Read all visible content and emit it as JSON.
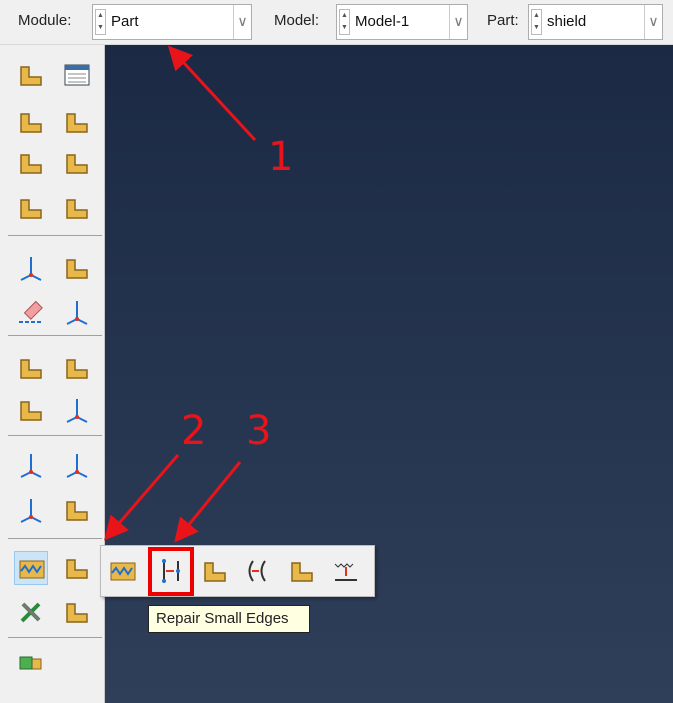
{
  "context_bar": {
    "module": {
      "label": "Module:",
      "value": "Part"
    },
    "model": {
      "label": "Model:",
      "value": "Model-1"
    },
    "part": {
      "label": "Part:",
      "value": "shield"
    }
  },
  "toolbox": {
    "icons": [
      "create-part-icon",
      "part-manager-icon",
      "create-solid-extrude-icon",
      "create-shell-extrude-icon",
      "create-wire-icon",
      "create-cut-extrude-icon",
      "create-round-icon",
      "mirror-icon",
      "create-datum-icon",
      "partition-icon",
      "delete-feature-icon",
      "query-icon",
      "create-set-icon",
      "partition-cell-icon",
      "partition-edge-icon",
      "datum-point-icon",
      "datum-axis-icon",
      "datum-plane-icon",
      "datum-csys-icon",
      "convert-to-analytical-icon",
      "geometry-repair-icon",
      "virtual-topology-icon",
      "tools-icon",
      "assembly-instance-icon",
      "translate-instance-icon"
    ]
  },
  "flyout": {
    "icons": [
      "repair-invalid-icon",
      "repair-small-edges-icon",
      "repair-small-faces-icon",
      "merge-edges-icon",
      "remove-redundant-entities-icon",
      "repair-sliver-icon",
      "remove-face-icon"
    ]
  },
  "tooltip": "Repair Small Edges",
  "annotations": [
    "1",
    "2",
    "3"
  ],
  "colors": {
    "annotation": "#e8141a",
    "highlight": "#cce4f7"
  }
}
